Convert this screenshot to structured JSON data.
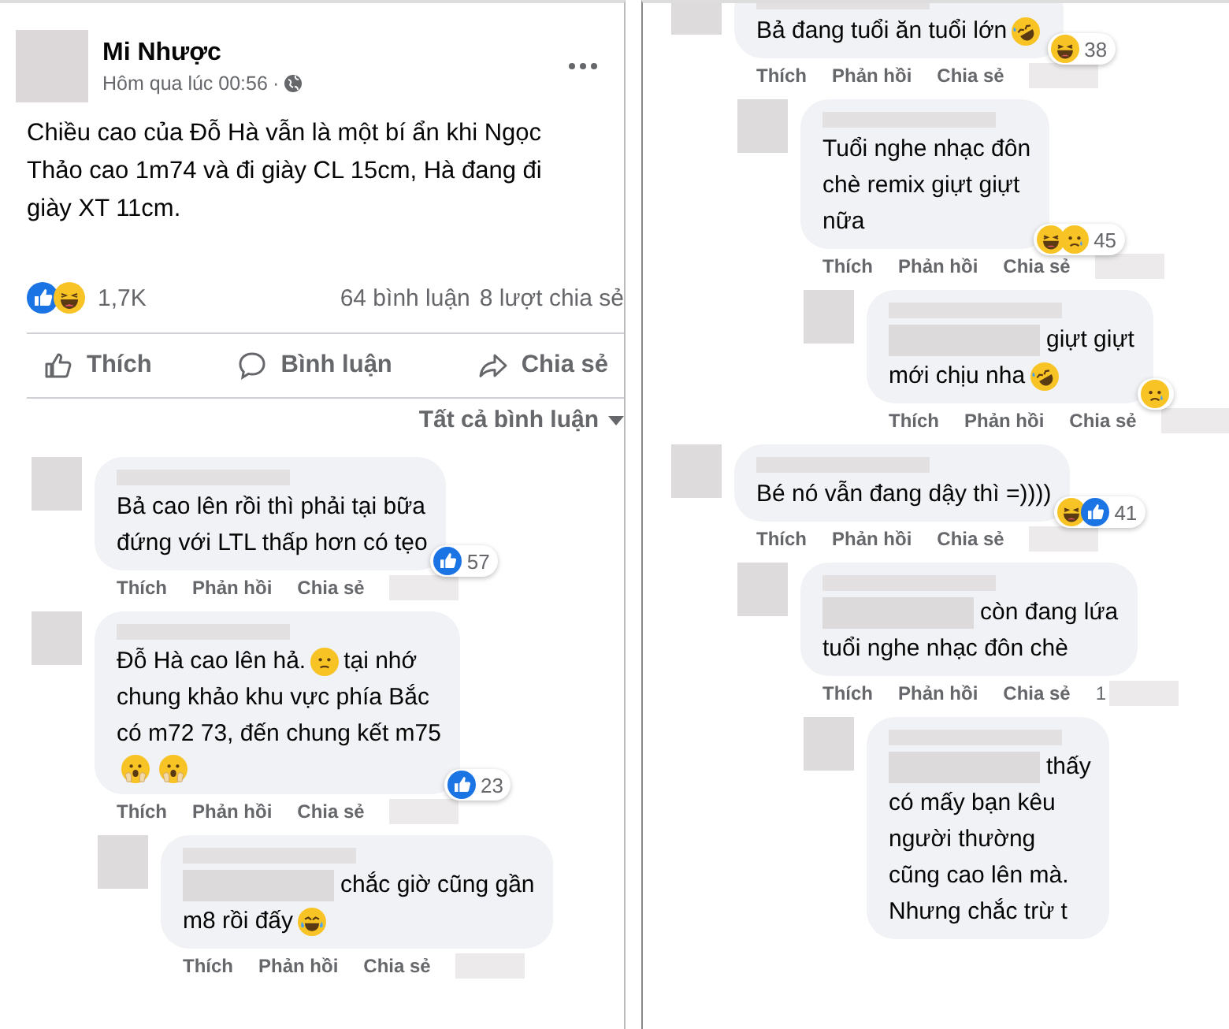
{
  "post": {
    "author": "Mi Nhược",
    "time": "Hôm qua lúc 00:56",
    "separator": "·",
    "text": "Chiều cao của Đỗ Hà vẫn là một bí ẩn khi Ngọc\nThảo cao 1m74 và đi giày CL 15cm, Hà đang đi\ngiày XT 11cm.",
    "reactions": [
      {
        "kind": "like"
      },
      {
        "kind": "haha"
      }
    ],
    "reaction_count": "1,7K",
    "comment_count": "64 bình luận",
    "share_count": "8 lượt chia sẻ",
    "actions": [
      {
        "kind": "like",
        "label": "Thích"
      },
      {
        "kind": "comment",
        "label": "Bình luận"
      },
      {
        "kind": "share",
        "label": "Chia sẻ"
      }
    ],
    "filter": "Tất cả bình luận"
  },
  "left_comments": [
    {
      "lines": [
        [
          {
            "kind": "text",
            "text": "Bả cao lên rồi thì phải tại bữa"
          }
        ],
        [
          {
            "kind": "text",
            "text": "đứng với LTL thấp hơn có tẹo"
          }
        ]
      ],
      "reactions": [
        {
          "kind": "like"
        }
      ],
      "reaction_count": "57",
      "actions": [
        "Thích",
        "Phản hồi",
        "Chia sẻ"
      ]
    },
    {
      "lines": [
        [
          {
            "kind": "text",
            "text": "Đỗ Hà cao lên hả."
          },
          {
            "kind": "frown"
          },
          {
            "kind": "text",
            "text": "tại nhớ"
          }
        ],
        [
          {
            "kind": "text",
            "text": "chung khảo khu vực phía Bắc"
          }
        ],
        [
          {
            "kind": "text",
            "text": "có m72 73, đến chung kết m75"
          }
        ],
        [
          {
            "kind": "gasp"
          },
          {
            "kind": "gasp"
          }
        ]
      ],
      "reactions": [
        {
          "kind": "like"
        }
      ],
      "reaction_count": "23",
      "actions": [
        "Thích",
        "Phản hồi",
        "Chia sẻ"
      ],
      "replies": [
        {
          "lines": [
            [
              {
                "kind": "redacted"
              },
              {
                "kind": "text",
                "text": "chắc giờ cũng gần"
              }
            ],
            [
              {
                "kind": "text",
                "text": "m8 rồi đấy"
              },
              {
                "kind": "joy"
              }
            ]
          ],
          "actions": [
            "Thích",
            "Phản hồi",
            "Chia sẻ"
          ]
        }
      ]
    }
  ],
  "right_comments": [
    {
      "lines": [
        [
          {
            "kind": "text",
            "text": "Bả đang tuổi ăn tuổi lớn"
          },
          {
            "kind": "rofl"
          }
        ]
      ],
      "reactions": [
        {
          "kind": "haha"
        }
      ],
      "reaction_count": "38",
      "actions": [
        "Thích",
        "Phản hồi",
        "Chia sẻ"
      ],
      "replies": [
        {
          "lines": [
            [
              {
                "kind": "text",
                "text": "Tuổi nghe nhạc đôn"
              }
            ],
            [
              {
                "kind": "text",
                "text": "chè remix giựt giựt"
              }
            ],
            [
              {
                "kind": "text",
                "text": "nữa"
              }
            ]
          ],
          "reactions": [
            {
              "kind": "haha"
            },
            {
              "kind": "sad"
            }
          ],
          "reaction_count": "45",
          "actions": [
            "Thích",
            "Phản hồi",
            "Chia sẻ"
          ],
          "replies": [
            {
              "lines": [
                [
                  {
                    "kind": "redacted"
                  },
                  {
                    "kind": "text",
                    "text": "giựt giựt"
                  }
                ],
                [
                  {
                    "kind": "text",
                    "text": "mới chịu nha"
                  },
                  {
                    "kind": "rofl"
                  }
                ]
              ],
              "reactions": [
                {
                  "kind": "sad"
                }
              ],
              "actions": [
                "Thích",
                "Phản hồi",
                "Chia sẻ"
              ]
            }
          ]
        }
      ]
    },
    {
      "lines": [
        [
          {
            "kind": "text",
            "text": "Bé nó vẫn đang dậy thì =))))"
          }
        ]
      ],
      "reactions": [
        {
          "kind": "haha"
        },
        {
          "kind": "like"
        }
      ],
      "reaction_count": "41",
      "actions": [
        "Thích",
        "Phản hồi",
        "Chia sẻ"
      ],
      "replies": [
        {
          "lines": [
            [
              {
                "kind": "redacted"
              },
              {
                "kind": "text",
                "text": "còn đang lứa"
              }
            ],
            [
              {
                "kind": "text",
                "text": "tuổi nghe nhạc đôn chè"
              }
            ]
          ],
          "actions": [
            "Thích",
            "Phản hồi",
            "Chia sẻ"
          ],
          "time": "1",
          "replies": [
            {
              "lines": [
                [
                  {
                    "kind": "redacted"
                  },
                  {
                    "kind": "text",
                    "text": "thấy"
                  }
                ],
                [
                  {
                    "kind": "text",
                    "text": "có mấy bạn kêu"
                  }
                ],
                [
                  {
                    "kind": "text",
                    "text": "người thường"
                  }
                ],
                [
                  {
                    "kind": "text",
                    "text": "cũng cao lên mà."
                  }
                ],
                [
                  {
                    "kind": "text",
                    "text": "Nhưng chắc trừ t"
                  }
                ]
              ]
            }
          ]
        }
      ]
    }
  ]
}
